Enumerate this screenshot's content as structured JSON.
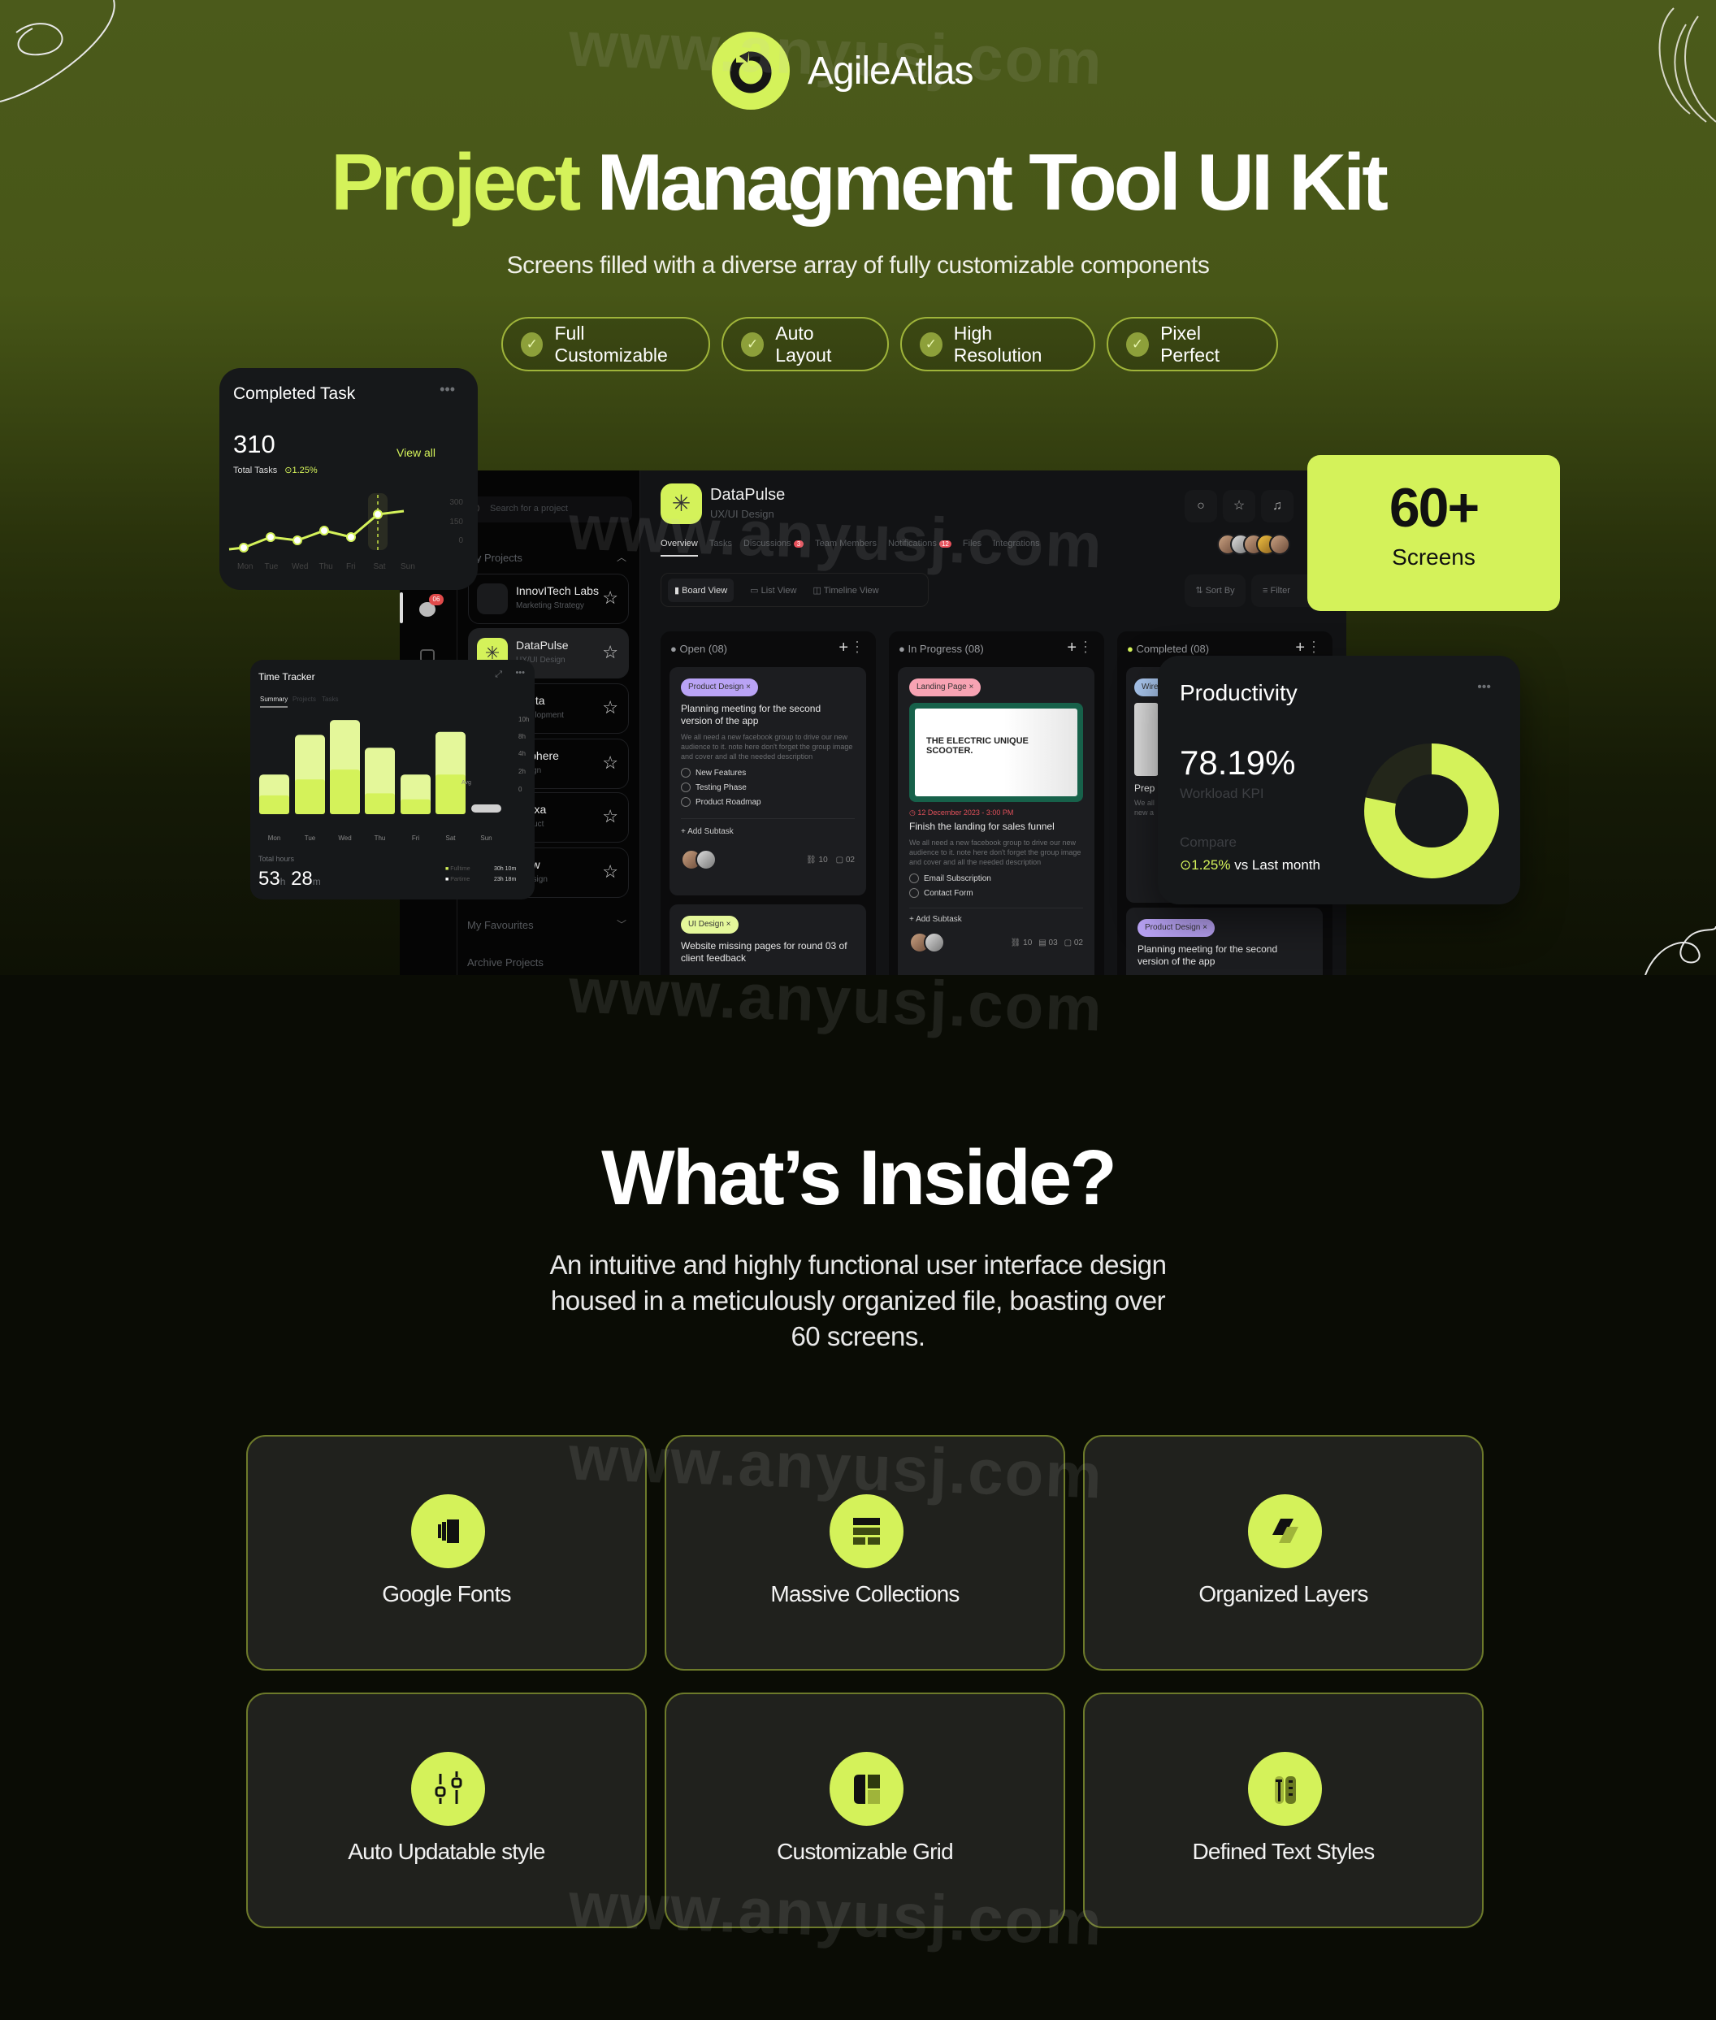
{
  "brand": {
    "name": "AgileAtlas",
    "accent": "#d4f25a"
  },
  "hero": {
    "title_highlight": "Project",
    "title_rest": "Managment Tool UI Kit",
    "subtitle": "Screens filled with a diverse array of fully customizable components",
    "badges": [
      "Full Customizable",
      "Auto Layout",
      "High Resolution",
      "Pixel Perfect"
    ]
  },
  "completed_task": {
    "title": "Completed Task",
    "count": "310",
    "count_label": "Total Tasks",
    "change": "1.25%",
    "view_all": "View all",
    "y_ticks": [
      "300",
      "150",
      "0"
    ],
    "days": [
      "Mon",
      "Tue",
      "Wed",
      "Thu",
      "Fri",
      "Sat",
      "Sun"
    ],
    "values": [
      5,
      70,
      50,
      110,
      70,
      210,
      230
    ]
  },
  "app": {
    "search_placeholder": "Search for a project",
    "my_projects": "My Projects",
    "notif_badge": "06",
    "projects": [
      {
        "name": "InnovITech Labs",
        "sub": "Marketing Strategy"
      },
      {
        "name": "DataPulse",
        "sub": "UX/UI Design"
      },
      {
        "name": "Vanta",
        "sub": "Development"
      },
      {
        "name": "eSphere",
        "sub": "Design"
      },
      {
        "name": "rNexa",
        "sub": "Product"
      },
      {
        "name": "Flow",
        "sub": "c Design"
      }
    ],
    "my_favourites": "My Favourites",
    "archive_projects": "Archive Projects",
    "project_title": "DataPulse",
    "project_sub": "UX/UI Design",
    "tabs": [
      {
        "label": "Overview"
      },
      {
        "label": "Tasks"
      },
      {
        "label": "Discussions",
        "badge": "3"
      },
      {
        "label": "Team Members"
      },
      {
        "label": "Notifications",
        "badge": "12"
      },
      {
        "label": "Files"
      },
      {
        "label": "Integrations"
      }
    ],
    "views": [
      "Board View",
      "List View",
      "Timeline View"
    ],
    "sort_by": "Sort By",
    "filter": "Filter",
    "columns": [
      {
        "title": "Open (08)",
        "cards": [
          {
            "tag": "Product Design",
            "tag_color": "#b9a3f5",
            "title": "Planning meeting for the second version of the app",
            "desc": "We all need a new facebook group to drive our new audience to it. note here don't forget the group image and cover and all the needed description",
            "subtasks": [
              "New Features",
              "Testing Phase",
              "Product Roadmap"
            ],
            "add": "Add Subtask",
            "links": "10",
            "comments": "02"
          },
          {
            "tag": "UI Design",
            "tag_color": "#e4f79a",
            "title": "Website missing pages for round 03 of client feedback"
          }
        ]
      },
      {
        "title": "In Progress (08)",
        "cards": [
          {
            "tag": "Landing Page",
            "tag_color": "#f7a3b3",
            "image_text": "THE ELECTRIC UNIQUE SCOOTER.",
            "date": "12 December 2023 - 3:00 PM",
            "title": "Finish the landing for sales funnel",
            "desc": "We all need a new facebook group to drive our new audience to it. note here don't forget the group image and cover and all the needed description",
            "subtasks": [
              "Email Subscription",
              "Contact Form"
            ],
            "add": "Add Subtask",
            "links": "10",
            "files": "03",
            "comments": "02"
          }
        ]
      },
      {
        "title": "Completed (08)",
        "cards": [
          {
            "tag": "Wire",
            "tag_color": "#a9c6ee",
            "title": "Prep",
            "desc": "We all new a"
          },
          {
            "tag": "Product Design",
            "tag_color": "#b9a3f5",
            "title": "Planning meeting for the second version of the app"
          }
        ]
      }
    ]
  },
  "screens_badge": {
    "value": "60+",
    "label": "Screens"
  },
  "time_tracker": {
    "title": "Time Tracker",
    "tabs": [
      "Summary",
      "Projects",
      "Tasks"
    ],
    "y_ticks": [
      "10h",
      "8h",
      "4h",
      "2h",
      "0"
    ],
    "avg_label": "Avg",
    "days": [
      "Mon",
      "Tue",
      "Wed",
      "Thu",
      "Fri",
      "Sat",
      "Sun"
    ],
    "total_hours_fraction": [
      0.4,
      0.8,
      0.95,
      0.67,
      0.4,
      0.83,
      0.1
    ],
    "fulltime_fraction": [
      0.19,
      0.35,
      0.45,
      0.21,
      0.15,
      0.4,
      0
    ],
    "total_label": "Total hours",
    "total_h": "53",
    "total_m": "28",
    "unit_h": "h",
    "unit_m": "m",
    "legend": [
      {
        "label": "Fulltime",
        "h": "30",
        "m": "10",
        "color": "#d4f25a"
      },
      {
        "label": "Partime",
        "h": "23",
        "m": "18",
        "color": "#ffffff"
      }
    ]
  },
  "productivity": {
    "title": "Productivity",
    "value": "78.19%",
    "value_num": 78.19,
    "kpi_label": "Workload KPI",
    "compare_label": "Compare",
    "change": "1.25%",
    "vs": "vs Last month"
  },
  "inside": {
    "title": "What’s Inside?",
    "desc_lines": [
      "An intuitive and highly functional user interface design",
      "housed in a meticulously organized file, boasting over",
      "60 screens."
    ],
    "features": [
      {
        "label": "Google Fonts",
        "icon": "font-book-icon"
      },
      {
        "label": "Massive Collections",
        "icon": "collections-icon"
      },
      {
        "label": "Organized Layers",
        "icon": "layers-icon"
      },
      {
        "label": "Auto Updatable style",
        "icon": "sliders-icon"
      },
      {
        "label": "Customizable Grid",
        "icon": "grid-icon"
      },
      {
        "label": "Defined Text Styles",
        "icon": "text-styles-icon"
      }
    ]
  },
  "watermark": "www.anyusj.com"
}
